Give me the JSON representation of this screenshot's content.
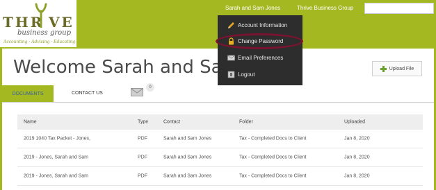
{
  "brand": {
    "logo_word_left": "THR",
    "logo_word_right": "VE",
    "logo_sub": "business group",
    "logo_tagline": "Accounting · Advising · Educating"
  },
  "topnav": {
    "user": "Sarah and Sam Jones",
    "firm": "Thrive Business Group",
    "search_value": ""
  },
  "page": {
    "welcome": "Welcome Sarah and Sam Jones",
    "upload_label": "Upload File"
  },
  "tabs": {
    "documents": "DOCUMENTS",
    "contact": "CONTACT US",
    "mail_count": "0"
  },
  "table": {
    "headers": [
      "Name",
      "Type",
      "Contact",
      "Folder",
      "Uploaded"
    ],
    "rows": [
      [
        "2019 1040 Tax Packet - Jones,",
        "PDF",
        "Sarah and Sam Jones",
        "Tax - Completed Docs to Client",
        "Jan 8, 2020"
      ],
      [
        "2019 - Jones, Sarah and Sam",
        "PDF",
        "Sarah and Sam Jones",
        "Tax - Completed Docs to Client",
        "Jan 8, 2020"
      ],
      [
        "2019 - Jones, Sarah and Sam",
        "PDF",
        "Sarah and Sam Jones",
        "Tax - Completed Docs to Client",
        "Jan 8, 2020"
      ]
    ]
  },
  "user_menu": {
    "items": [
      {
        "label": "Account Information",
        "icon": "pencil-icon"
      },
      {
        "label": "Change Password",
        "icon": "lock-icon"
      },
      {
        "label": "Email Preferences",
        "icon": "mail-icon"
      },
      {
        "label": "Logout",
        "icon": "logout-icon"
      }
    ],
    "highlighted_item": "Change Password",
    "highlight_color": "#7a1330"
  },
  "colors": {
    "brand_green": "#a3b821",
    "tab_text": "#3b5e9a",
    "menu_bg": "#2d2d2d"
  }
}
